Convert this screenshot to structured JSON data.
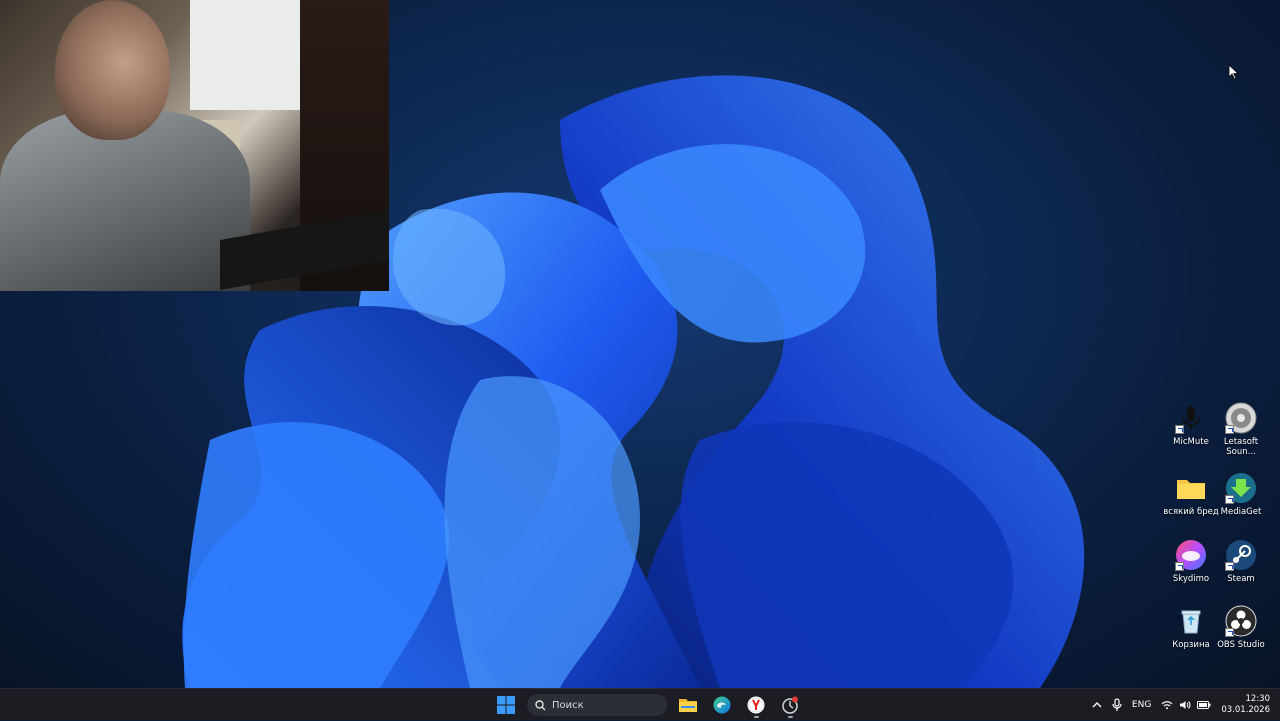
{
  "desktop": {
    "icons": [
      {
        "id": "micmute",
        "label": "MicMute",
        "icon": "microphone-icon",
        "shortcut": true
      },
      {
        "id": "letasoft",
        "label": "Letasoft Soun...",
        "icon": "speaker-icon",
        "shortcut": true
      },
      {
        "id": "folder",
        "label": "всякий бред",
        "icon": "folder-icon",
        "shortcut": false
      },
      {
        "id": "mediaget",
        "label": "MediaGet",
        "icon": "download-icon",
        "shortcut": true
      },
      {
        "id": "skydimo",
        "label": "Skydimo",
        "icon": "skydimo-icon",
        "shortcut": true
      },
      {
        "id": "steam",
        "label": "Steam",
        "icon": "steam-icon",
        "shortcut": true
      },
      {
        "id": "recycle",
        "label": "Корзина",
        "icon": "recycle-bin-icon",
        "shortcut": false
      },
      {
        "id": "obs",
        "label": "OBS Studio",
        "icon": "obs-icon",
        "shortcut": true
      }
    ]
  },
  "taskbar": {
    "search_placeholder": "Поиск",
    "apps": [
      "file-explorer-icon",
      "edge-icon",
      "yandex-browser-icon",
      "app-with-badge-icon"
    ],
    "tray": {
      "language": "ENG",
      "time": "12:30",
      "date": "03.01.2026"
    }
  },
  "colors": {
    "accent": "#1e6bff",
    "taskbar_bg": "#1b1d22"
  }
}
